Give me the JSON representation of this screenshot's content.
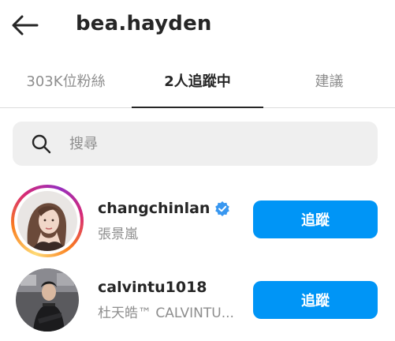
{
  "header": {
    "title": "bea.hayden",
    "back_icon": "arrow-left-icon"
  },
  "tabs": [
    {
      "label": "303K位粉絲",
      "active": false
    },
    {
      "label": "2人追蹤中",
      "active": true
    },
    {
      "label": "建議",
      "active": false
    }
  ],
  "search": {
    "placeholder": "搜尋",
    "icon": "search-icon"
  },
  "users": [
    {
      "username": "changchinlan",
      "fullname": "張景嵐",
      "verified": true,
      "has_story": true,
      "button_label": "追蹤"
    },
    {
      "username": "calvintu1018",
      "fullname": "杜天皓™ CALVINTU...",
      "verified": false,
      "has_story": false,
      "button_label": "追蹤"
    }
  ],
  "colors": {
    "accent": "#0095f6",
    "text": "#262626",
    "secondary_text": "#8e8e8e",
    "search_bg": "#efefef"
  }
}
